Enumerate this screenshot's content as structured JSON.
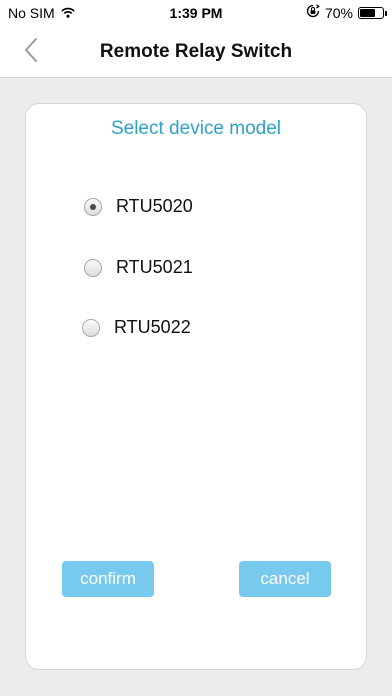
{
  "status_bar": {
    "carrier": "No SIM",
    "time": "1:39 PM",
    "battery": "70%",
    "battery_level": 0.7
  },
  "nav": {
    "title": "Remote Relay Switch",
    "back_icon": "chevron-left-icon"
  },
  "dialog": {
    "title": "Select device model",
    "options": [
      {
        "label": "RTU5020",
        "selected": true
      },
      {
        "label": "RTU5021",
        "selected": false
      },
      {
        "label": "RTU5022",
        "selected": false
      }
    ],
    "confirm_label": "confirm",
    "cancel_label": "cancel"
  },
  "colors": {
    "accent": "#2aa3c6",
    "button": "#78c9ee"
  }
}
